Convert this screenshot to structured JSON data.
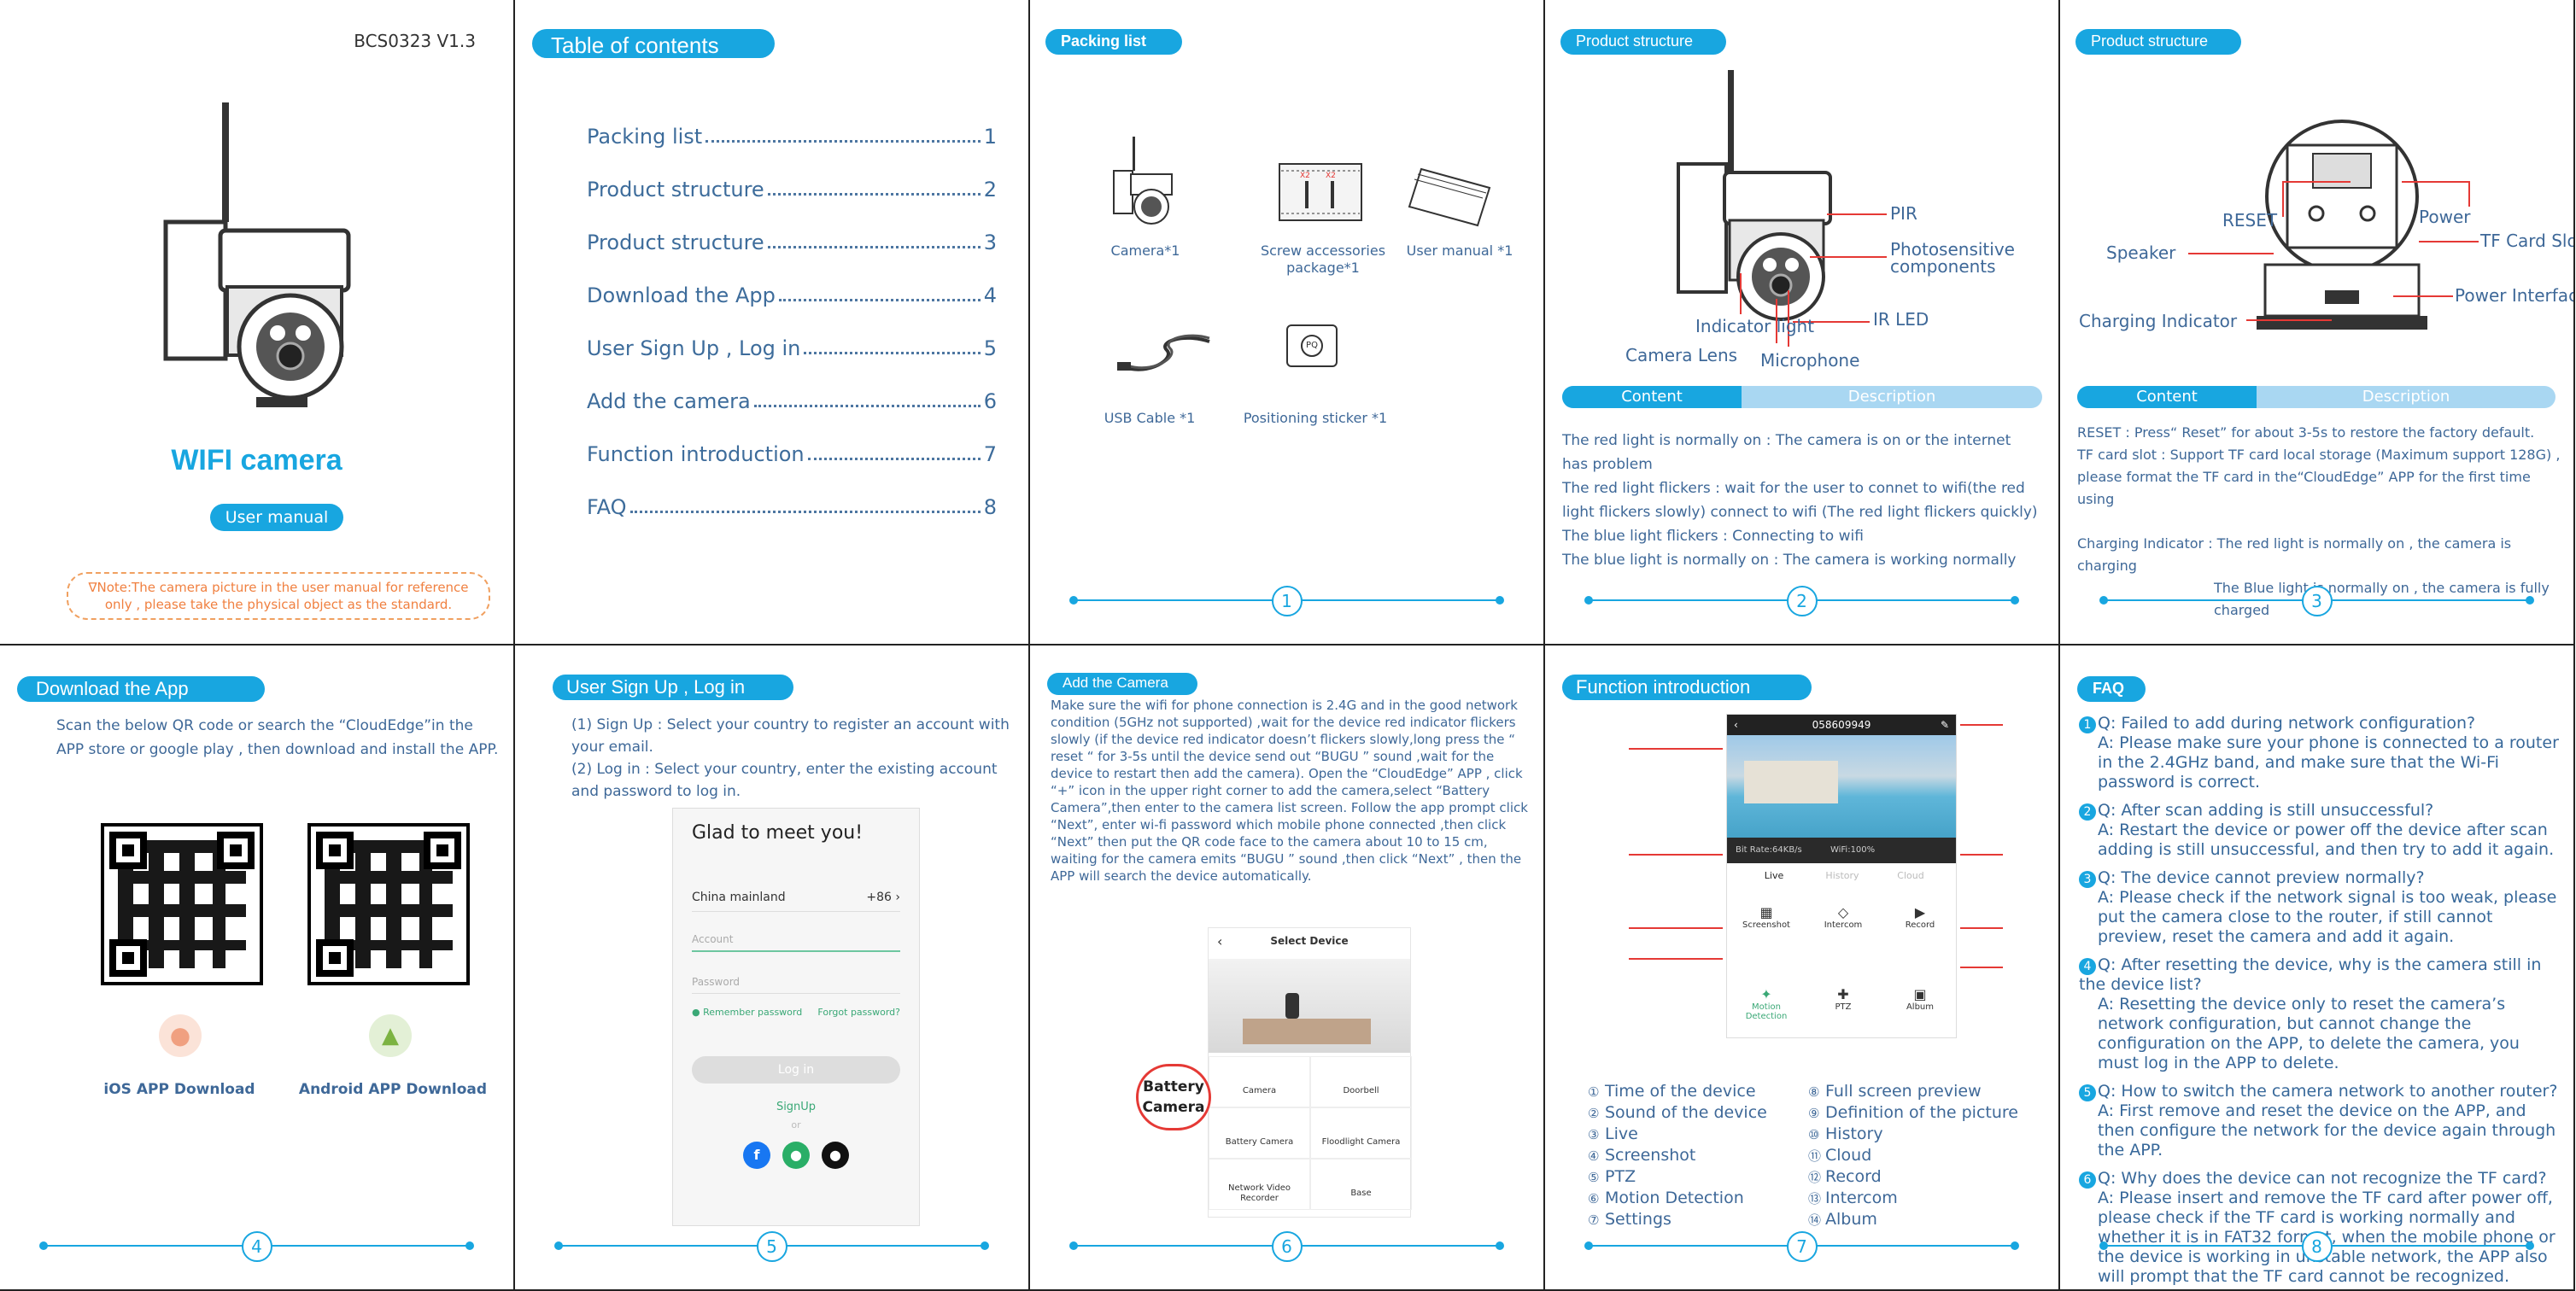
{
  "cover": {
    "code": "BCS0323  V1.3",
    "title": "WIFI camera",
    "manual": "User manual",
    "note": "∇Note:The camera picture in the user manual for reference only , please take the physical object as the standard."
  },
  "toc": {
    "header": "Table of contents",
    "items": [
      {
        "label": "Packing list",
        "page": "1"
      },
      {
        "label": "Product structure",
        "page": "2"
      },
      {
        "label": "Product structure",
        "page": "3"
      },
      {
        "label": "Download the App",
        "page": "4"
      },
      {
        "label": "User Sign Up , Log in",
        "page": "5"
      },
      {
        "label": "Add the camera",
        "page": "6"
      },
      {
        "label": "Function introduction",
        "page": "7"
      },
      {
        "label": "FAQ",
        "page": "8"
      }
    ]
  },
  "packing": {
    "header": "Packing list",
    "items": [
      "Camera*1",
      "Screw accessories package*1",
      "User manual *1",
      "USB Cable *1",
      "Positioning sticker *1"
    ],
    "screw_tags": [
      "X2",
      "X2"
    ],
    "sticker_text": "PQ",
    "page": "1"
  },
  "structure1": {
    "header": "Product structure",
    "labels": [
      "PIR",
      "Photosensitive components",
      "IR LED",
      "Microphone",
      "Camera Lens",
      "Indicator light"
    ],
    "table": {
      "col1": "Content",
      "col2": "Description"
    },
    "rows": [
      "The red light is normally on : The camera is on or the internet has problem",
      "The red light flickers : wait for the user to connet to wifi(the red light flickers slowly) connect to wifi (The red light flickers quickly)",
      "The blue light flickers : Connecting to wifi",
      "The blue light is normally on : The camera is working normally"
    ],
    "page": "2"
  },
  "structure2": {
    "header": "Product structure",
    "labels": [
      "RESET",
      "Power",
      "Speaker",
      "TF Card Slot",
      "Power Interface",
      "Charging Indicator"
    ],
    "table": {
      "col1": "Content",
      "col2": "Description"
    },
    "rows": [
      "RESET :  Press“ Reset” for about 3-5s to restore the factory default.",
      "TF card slot : Support TF card local storage (Maximum support 128G) , please format the TF card in the“CloudEdge” APP for the first time using",
      "Charging Indicator : The red light is normally on , the camera is charging",
      "The Blue light is normally on , the camera is fully charged"
    ],
    "page": "3"
  },
  "download": {
    "header": "Download the App",
    "text": "Scan the below QR code or search the “CloudEdge”in the APP store or google play , then download and install the APP.",
    "ios": "iOS APP Download",
    "android": "Android APP Download",
    "page": "4"
  },
  "signup": {
    "header": "User Sign Up , Log in",
    "step1": "(1)  Sign Up : Select your country to register an account with your email.",
    "step2": "(2)  Log in : Select your country, enter the existing account and password to log in.",
    "phone": {
      "greeting": "Glad to meet you!",
      "country": "China mainland",
      "code": "+86  ›",
      "account": "Account",
      "password": "Password",
      "remember": "Remember password",
      "forgot": "Forgot password?",
      "login": "Log in",
      "signup": "SignUp",
      "or": "or"
    },
    "page": "5"
  },
  "addcam": {
    "header": "Add the Camera",
    "text": "Make sure the wifi for phone connection is 2.4G and in the good network condition (5GHz not supported) ,wait for the device red indicator flickers slowly (if the device red indicator doesn’t flickers slowly,long press the “ reset “ for 3-5s until the device send out “BUGU ” sound ,wait for the device to restart then add the camera). Open the “CloudEdge” APP , click “+” icon in the upper right corner to add the camera,select “Battery Camera”,then enter to the camera list screen. Follow the app prompt click “Next”, enter wi-fi password which mobile phone connected ,then click “Next” then put the QR code face to the camera about 10 to 15 cm, waiting for the camera emits “BUGU ” sound ,then click  “Next” ,  then the APP will search the device automatically.",
    "select_title": "Select Device",
    "callout": "Battery Camera",
    "devices": [
      "Camera",
      "Doorbell",
      "Battery Camera",
      "Floodlight Camera",
      "Network Video Recorder",
      "Base"
    ],
    "page": "6"
  },
  "function": {
    "header": "Function introduction",
    "device_id": "058609949",
    "bitrate": "Bit Rate:64KB/s",
    "wifi": "WiFi:100%",
    "tabs": [
      "Live",
      "History",
      "Cloud"
    ],
    "controls": [
      "Screenshot",
      "Intercom",
      "Record",
      "Motion Detection",
      "PTZ",
      "Album"
    ],
    "left": [
      "Time of the device",
      "Sound of the device",
      "Live",
      "Screenshot",
      "PTZ",
      "Motion Detection",
      "Settings"
    ],
    "right": [
      "Full screen preview",
      "Definition of the picture",
      "History",
      "Cloud",
      "Record",
      "Intercom",
      "Album"
    ],
    "page": "7"
  },
  "faq": {
    "header": "FAQ",
    "items": [
      {
        "q": "Q: Failed to add during network configuration?",
        "a": "A: Please make sure your phone is connected to a router in the 2.4GHz band, and make sure that the Wi-Fi password is correct."
      },
      {
        "q": "Q: After scan adding is still unsuccessful?",
        "a": "A: Restart the device or power off the device after scan adding is still unsuccessful, and then try to add it again."
      },
      {
        "q": "Q: The device cannot preview normally?",
        "a": "A: Please check if the network signal is too weak, please put the camera close to the router, if still cannot preview, reset the camera and add it again."
      },
      {
        "q": "Q: After resetting the device, why is the camera still in the device list?",
        "a": "A: Resetting the device only to reset the camera’s network configuration, but cannot change the configuration on the APP, to delete the camera, you must log in the APP to delete."
      },
      {
        "q": "Q: How to switch the camera network to another router?",
        "a": "A: First remove and reset the device on the APP, and then configure the network for the device again through the APP."
      },
      {
        "q": "Q: Why does the device can not recognize the TF card?",
        "a": "A: Please insert and remove the TF card after power off, please check if the TF card is working normally and whether it is in FAT32 format, when the mobile phone or the device is working in unstable network, the APP also will prompt that the TF card cannot be recognized."
      }
    ],
    "page": "8"
  },
  "colors": {
    "accent": "#18a6e0",
    "text": "#3e6898",
    "red": "#e53935",
    "orange": "#f0a060"
  }
}
